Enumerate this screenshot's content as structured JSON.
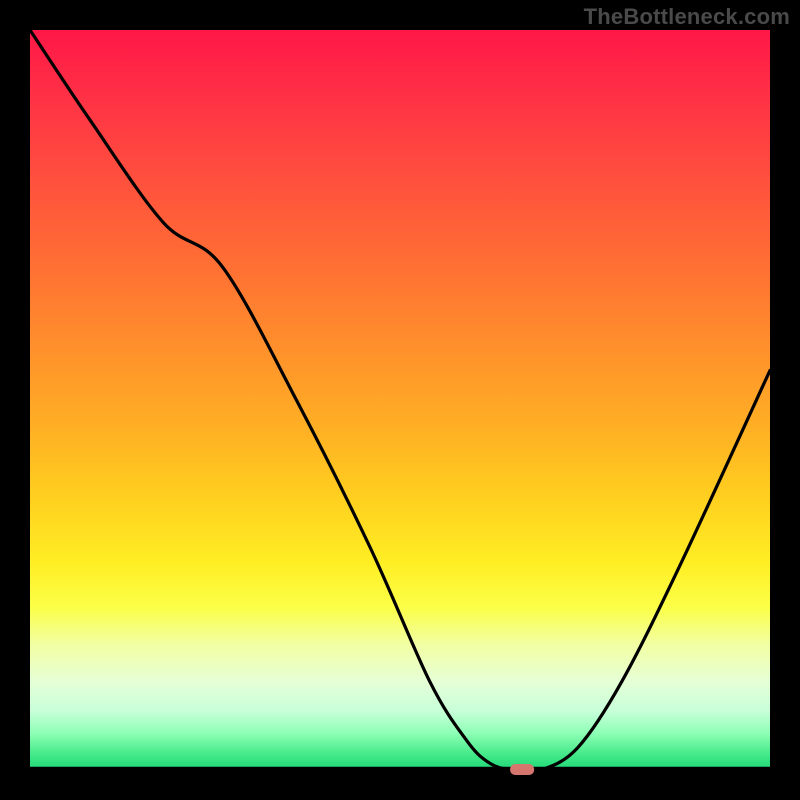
{
  "watermark": "TheBottleneck.com",
  "chart_data": {
    "type": "line",
    "title": "",
    "xlabel": "",
    "ylabel": "",
    "xlim": [
      0,
      100
    ],
    "ylim": [
      0,
      100
    ],
    "series": [
      {
        "name": "curve",
        "x": [
          0,
          8,
          18,
          26,
          36,
          46,
          54,
          59,
          62,
          65,
          69,
          74,
          80,
          88,
          100
        ],
        "values": [
          100,
          88,
          74,
          68,
          50,
          30,
          12,
          4,
          1,
          0,
          0,
          3,
          12,
          28,
          54
        ]
      }
    ],
    "marker": {
      "x": 66.5,
      "y": 0
    },
    "colors": {
      "top": "#ff1747",
      "mid": "#ffd21f",
      "bottom": "#1ed978",
      "curve": "#000000",
      "marker": "#d4766d"
    }
  }
}
